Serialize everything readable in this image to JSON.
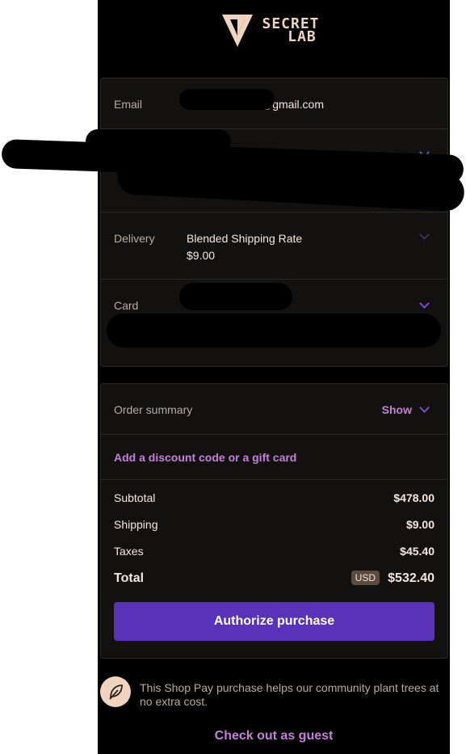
{
  "brand": {
    "logo_text_line1": "SECRET",
    "logo_text_line2": "LAB"
  },
  "contact": {
    "email_label": "Email",
    "email_value": "@gmail.com",
    "delivery_label": "Delivery",
    "delivery_method": "Blended Shipping Rate",
    "delivery_price": "$9.00",
    "card_label": "Card"
  },
  "order_summary": {
    "title": "Order summary",
    "toggle_label": "Show",
    "discount_link": "Add a discount code or a gift card",
    "lines": [
      {
        "label": "Subtotal",
        "amount": "$478.00"
      },
      {
        "label": "Shipping",
        "amount": "$9.00"
      },
      {
        "label": "Taxes",
        "amount": "$45.40"
      }
    ],
    "total_label": "Total",
    "currency": "USD",
    "total_amount": "$532.40",
    "authorize_label": "Authorize purchase"
  },
  "footer": {
    "tree_message": "This Shop Pay purchase helps our community plant trees at no extra cost.",
    "guest_checkout": "Check out as guest"
  },
  "colors": {
    "accent": "#5a31b9",
    "link": "#c480d8",
    "card_bg": "#13110f",
    "logo": "#f1d4bd"
  }
}
